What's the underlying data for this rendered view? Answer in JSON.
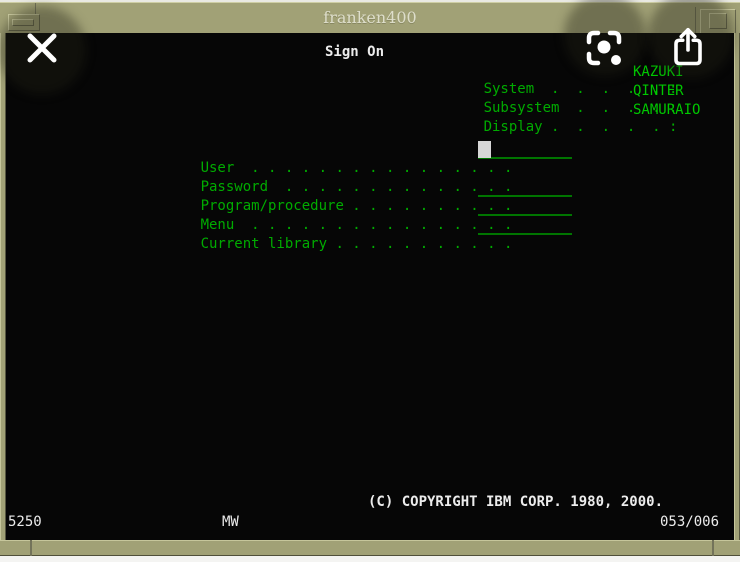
{
  "window": {
    "title": "franken400",
    "menu_button_icon": "window-menu-dash",
    "maximize_button_icon": "maximize-square"
  },
  "terminal": {
    "screen_title": "Sign On",
    "system_info": [
      {
        "label": "System",
        "dots": "  .  .  .  .  . :",
        "value": "KAZUKI"
      },
      {
        "label": "Subsystem",
        "dots": "  .  .  .  . :",
        "value": "QINTER"
      },
      {
        "label": "Display",
        "dots": " .  .  .  .  . :",
        "value": "SAMURAIO"
      }
    ],
    "fields": [
      {
        "label": "User",
        "dots": "  . . . . . . . . . . . . . . . ."
      },
      {
        "label": "Password",
        "dots": "  . . . . . . . . . . . . . ."
      },
      {
        "label": "Program/procedure",
        "dots": " . . . . . . . . . ."
      },
      {
        "label": "Menu",
        "dots": "  . . . . . . . . . . . . . . . ."
      },
      {
        "label": "Current library",
        "dots": " . . . . . . . . . . ."
      }
    ],
    "copyright": "(C) COPYRIGHT IBM CORP. 1980, 2000.",
    "status_bar": {
      "left": "5250",
      "center": "MW",
      "right": "053/006"
    }
  },
  "overlay_icons": {
    "close": "close-x-icon",
    "lens": "lens-search-icon",
    "share": "share-icon"
  },
  "colors": {
    "green": "#00AB00",
    "green_bright": "#00C800",
    "green_dim": "#007500",
    "white": "#ECECEC",
    "olive": "#A1A176"
  }
}
